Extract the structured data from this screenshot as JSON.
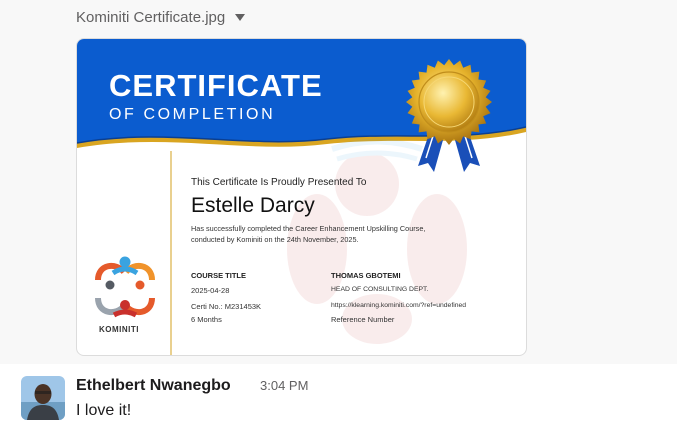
{
  "file": {
    "name": "Kominiti Certificate.jpg",
    "menu_icon": "caret-down-icon"
  },
  "certificate": {
    "title": "CERTIFICATE",
    "subtitle": "OF COMPLETION",
    "presented_to": "This Certificate Is Proudly Presented To",
    "recipient": "Estelle Darcy",
    "description_line1": "Has successfully completed the Career Enhancement Upskilling Course,",
    "description_line2": "conducted by Kominiti on the 24th November, 2025.",
    "course_title_label": "COURSE TITLE",
    "date": "2025-04-28",
    "cert_no": "Certi No.: M231453K",
    "duration": "6 Months",
    "signer_name": "THOMAS GBOTEMI",
    "signer_role": "HEAD OF CONSULTING DEPT.",
    "link": "https://klearning.kominiti.com/?ref=undefined",
    "reference_label": "Reference Number",
    "logo_text": "KOMINITI",
    "colors": {
      "header_blue": "#0b5ccf",
      "gold": "#d9a521",
      "ribbon_blue": "#1a4fb8"
    }
  },
  "message": {
    "sender": "Ethelbert Nwanegbo",
    "time": "3:04 PM",
    "text": "I love it!"
  }
}
